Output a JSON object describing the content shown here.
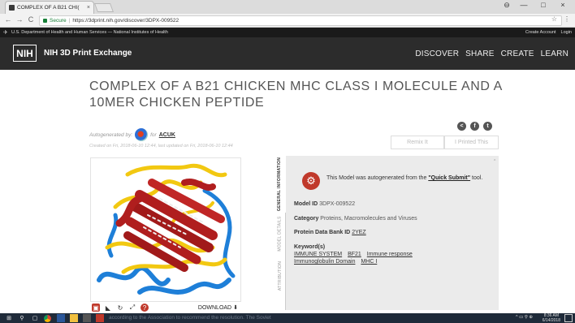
{
  "browser": {
    "tab_title": "COMPLEX OF A B21 CHI(",
    "tab_close": "×",
    "url_secure_label": "Secure",
    "url_separator": "|",
    "url": "https://3dprint.nih.gov/discover/3DPX-009522",
    "back": "←",
    "forward": "→",
    "reload": "C",
    "star": "☆",
    "menu": "⋮",
    "minimize": "—",
    "maximize": "□",
    "close": "×",
    "account": "⊖"
  },
  "govbar": {
    "text": "U.S. Department of Health and Human Services — National Institutes of Health",
    "create_account": "Create Account",
    "login": "Login"
  },
  "header": {
    "logo": "NIH",
    "site_title": "NIH 3D Print Exchange",
    "nav": [
      "DISCOVER",
      "SHARE",
      "CREATE",
      "LEARN"
    ]
  },
  "model": {
    "title": "COMPLEX OF A B21 CHICKEN MHC CLASS I MOLECULE AND A 10MER CHICKEN PEPTIDE",
    "autogenerated_by": "Autogenerated by:",
    "for": "for",
    "author": "ACUK",
    "created": "Created on Fri, 2018-06-10 12:44, last updated on Fri, 2018-06-10 12:44",
    "remix_label": "Remix It",
    "printed_label": "I Printed This",
    "download_label": "DOWNLOAD"
  },
  "social": {
    "share": "<",
    "facebook": "f",
    "twitter": "t"
  },
  "panel": {
    "tabs": [
      "GENERAL INFORMATION",
      "MODEL DETAILS",
      "ATTRIBUTION"
    ],
    "autogen_prefix": "This Model was autogenerated from the",
    "quick_submit": "\"Quick Submit\"",
    "autogen_suffix": "tool.",
    "model_id_label": "Model ID",
    "model_id": "3DPX-009522",
    "category_label": "Category",
    "category": "Proteins, Macromolecules and Viruses",
    "pdb_label": "Protein Data Bank ID",
    "pdb_id": "2YEZ",
    "keywords_label": "Keyword(s)",
    "keywords": [
      "IMMUNE SYSTEM",
      "BF21",
      "Immune response",
      "Immunoglobulin Domain",
      "MHC I"
    ],
    "scroll_caret": "^"
  },
  "taskbar": {
    "marquee": "according to the Association to recommend the resolution. The Soviet",
    "time": "8:36 AM",
    "date": "6/14/2018",
    "tray": "^ ▭ ⚲ ⊕"
  },
  "colors": {
    "header_bg": "#2c2c2c",
    "govbar_bg": "#1a1a1a",
    "panel_bg": "#ebebeb",
    "accent_red": "#c0392b",
    "title_gray": "#555555"
  }
}
